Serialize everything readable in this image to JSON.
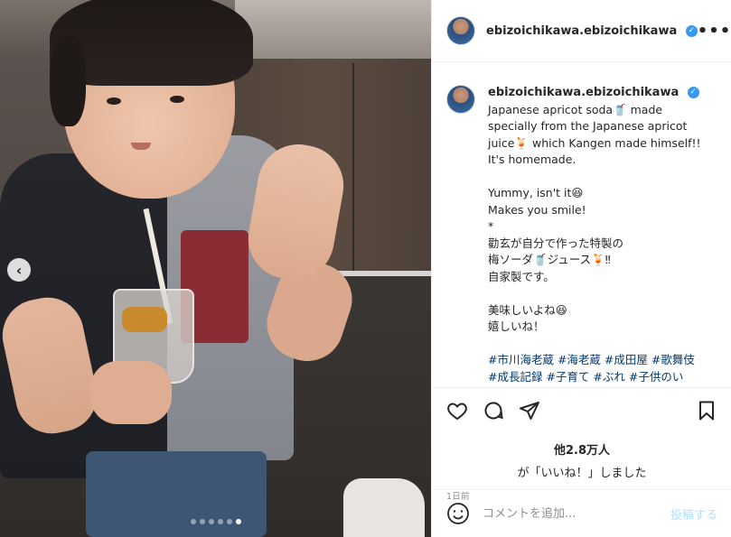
{
  "post": {
    "username": "ebizoichikawa.ebizoichikawa",
    "verified_symbol": "✓",
    "more_symbol": "•••"
  },
  "caption": {
    "username": "ebizoichikawa.ebizoichikawa",
    "lines": [
      "Japanese apricot soda🥤 made",
      "specially from the Japanese apricot",
      "juice🍹 which Kangen made himself!!",
      "It's homemade.",
      "",
      "Yummy, isn't it😆",
      "Makes you smile!",
      "*",
      "勸玄が自分で作った特製の",
      "梅ソーダ🥤ジュース🍹‼",
      "自家製です。",
      "",
      "美味しいよね😆",
      "嬉しいね！",
      ""
    ],
    "hashtags": "#市川海老蔵 #海老蔵 #成田屋 #歌舞伎",
    "hashtags_cut": "#成長記録 #子育て #ぶれ #子供のい"
  },
  "carousel": {
    "prev_symbol": "‹",
    "dot_count": 6,
    "active_index": 5
  },
  "actions": {
    "likes_count": "他2.8万人",
    "likes_text": "が「いいね！」しました",
    "timestamp": "1日前"
  },
  "comment_box": {
    "placeholder": "コメントを追加...",
    "post_label": "投稿する"
  },
  "colors": {
    "link": "#00376b",
    "verified": "#3897f0",
    "post_button_disabled": "#b2dffc",
    "muted": "#8e8e8e"
  }
}
